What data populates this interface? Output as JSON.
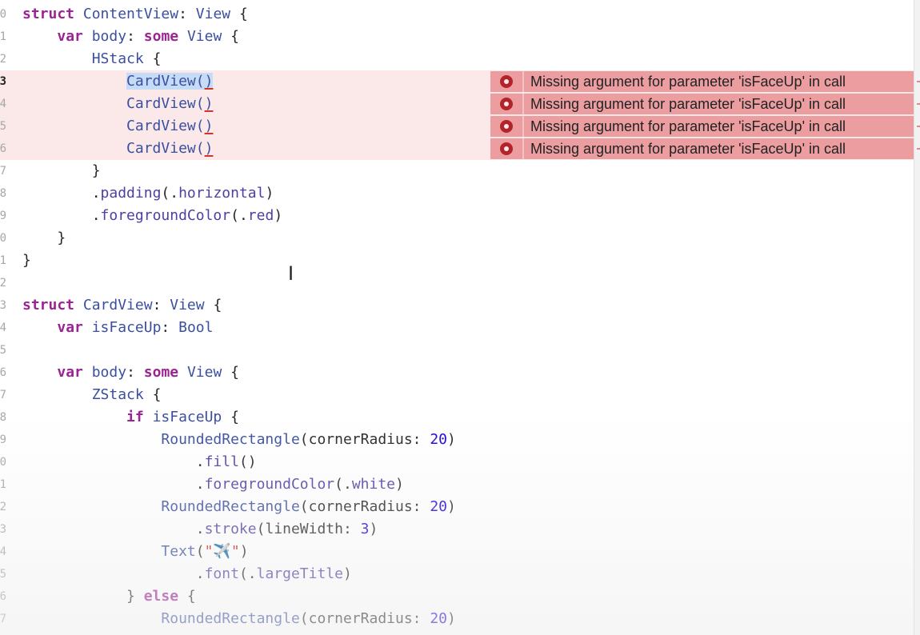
{
  "editor": {
    "lines": [
      {
        "n": "0",
        "tokens": [
          [
            "kw",
            "struct "
          ],
          [
            "ty",
            "ContentView"
          ],
          [
            "plain",
            ": "
          ],
          [
            "ty",
            "View"
          ],
          [
            "plain",
            " {"
          ]
        ]
      },
      {
        "n": "1",
        "tokens": [
          [
            "plain",
            "    "
          ],
          [
            "kw",
            "var "
          ],
          [
            "ty",
            "body"
          ],
          [
            "plain",
            ": "
          ],
          [
            "kw",
            "some "
          ],
          [
            "ty",
            "View"
          ],
          [
            "plain",
            " {"
          ]
        ]
      },
      {
        "n": "2",
        "tokens": [
          [
            "plain",
            "        "
          ],
          [
            "ty",
            "HStack"
          ],
          [
            "plain",
            " {"
          ]
        ]
      },
      {
        "n": "3",
        "tokens": [
          [
            "plain",
            "            "
          ],
          [
            "ty sel",
            "CardView("
          ],
          [
            "ty sel err-underline",
            ")"
          ]
        ],
        "error": true,
        "active": true
      },
      {
        "n": "4",
        "tokens": [
          [
            "plain",
            "            "
          ],
          [
            "ty",
            "CardView("
          ],
          [
            "ty err-underline",
            ")"
          ]
        ],
        "error": true
      },
      {
        "n": "5",
        "tokens": [
          [
            "plain",
            "            "
          ],
          [
            "ty",
            "CardView("
          ],
          [
            "ty err-underline",
            ")"
          ]
        ],
        "error": true
      },
      {
        "n": "6",
        "tokens": [
          [
            "plain",
            "            "
          ],
          [
            "ty",
            "CardView("
          ],
          [
            "ty err-underline",
            ")"
          ]
        ],
        "error": true
      },
      {
        "n": "7",
        "tokens": [
          [
            "plain",
            "        }"
          ]
        ]
      },
      {
        "n": "8",
        "tokens": [
          [
            "plain",
            "        ."
          ],
          [
            "fn",
            "padding"
          ],
          [
            "plain",
            "(."
          ],
          [
            "fn",
            "horizontal"
          ],
          [
            "plain",
            ")"
          ]
        ]
      },
      {
        "n": "9",
        "tokens": [
          [
            "plain",
            "        ."
          ],
          [
            "fn",
            "foregroundColor"
          ],
          [
            "plain",
            "(."
          ],
          [
            "fn",
            "red"
          ],
          [
            "plain",
            ")"
          ]
        ]
      },
      {
        "n": "0",
        "tokens": [
          [
            "plain",
            "    }"
          ]
        ]
      },
      {
        "n": "1",
        "tokens": [
          [
            "plain",
            "}"
          ]
        ]
      },
      {
        "n": "2",
        "tokens": []
      },
      {
        "n": "3",
        "tokens": [
          [
            "kw",
            "struct "
          ],
          [
            "ty",
            "CardView"
          ],
          [
            "plain",
            ": "
          ],
          [
            "ty",
            "View"
          ],
          [
            "plain",
            " {"
          ]
        ]
      },
      {
        "n": "4",
        "tokens": [
          [
            "plain",
            "    "
          ],
          [
            "kw",
            "var "
          ],
          [
            "ty",
            "isFaceUp"
          ],
          [
            "plain",
            ": "
          ],
          [
            "ty",
            "Bool"
          ]
        ]
      },
      {
        "n": "5",
        "tokens": []
      },
      {
        "n": "6",
        "tokens": [
          [
            "plain",
            "    "
          ],
          [
            "kw",
            "var "
          ],
          [
            "ty",
            "body"
          ],
          [
            "plain",
            ": "
          ],
          [
            "kw",
            "some "
          ],
          [
            "ty",
            "View"
          ],
          [
            "plain",
            " {"
          ]
        ]
      },
      {
        "n": "7",
        "tokens": [
          [
            "plain",
            "        "
          ],
          [
            "ty",
            "ZStack"
          ],
          [
            "plain",
            " {"
          ]
        ]
      },
      {
        "n": "8",
        "tokens": [
          [
            "plain",
            "            "
          ],
          [
            "kw",
            "if "
          ],
          [
            "ty",
            "isFaceUp"
          ],
          [
            "plain",
            " {"
          ]
        ]
      },
      {
        "n": "9",
        "tokens": [
          [
            "plain",
            "                "
          ],
          [
            "ty",
            "RoundedRectangle"
          ],
          [
            "plain",
            "(cornerRadius: "
          ],
          [
            "num",
            "20"
          ],
          [
            "plain",
            ")"
          ]
        ]
      },
      {
        "n": "0",
        "tokens": [
          [
            "plain",
            "                    ."
          ],
          [
            "fn",
            "fill"
          ],
          [
            "plain",
            "()"
          ]
        ]
      },
      {
        "n": "1",
        "tokens": [
          [
            "plain",
            "                    ."
          ],
          [
            "fn",
            "foregroundColor"
          ],
          [
            "plain",
            "(."
          ],
          [
            "fn",
            "white"
          ],
          [
            "plain",
            ")"
          ]
        ]
      },
      {
        "n": "2",
        "tokens": [
          [
            "plain",
            "                "
          ],
          [
            "ty",
            "RoundedRectangle"
          ],
          [
            "plain",
            "(cornerRadius: "
          ],
          [
            "num",
            "20"
          ],
          [
            "plain",
            ")"
          ]
        ]
      },
      {
        "n": "3",
        "tokens": [
          [
            "plain",
            "                    ."
          ],
          [
            "fn",
            "stroke"
          ],
          [
            "plain",
            "(lineWidth: "
          ],
          [
            "num",
            "3"
          ],
          [
            "plain",
            ")"
          ]
        ]
      },
      {
        "n": "4",
        "tokens": [
          [
            "plain",
            "                "
          ],
          [
            "ty",
            "Text"
          ],
          [
            "plain",
            "("
          ],
          [
            "str",
            "\"✈️\""
          ],
          [
            "plain",
            ")"
          ]
        ]
      },
      {
        "n": "5",
        "tokens": [
          [
            "plain",
            "                    ."
          ],
          [
            "fn",
            "font"
          ],
          [
            "plain",
            "(."
          ],
          [
            "fn",
            "largeTitle"
          ],
          [
            "plain",
            ")"
          ]
        ]
      },
      {
        "n": "6",
        "tokens": [
          [
            "plain",
            "            } "
          ],
          [
            "kw",
            "else"
          ],
          [
            "plain",
            " {"
          ]
        ]
      },
      {
        "n": "7",
        "tokens": [
          [
            "plain",
            "                "
          ],
          [
            "ty",
            "RoundedRectangle"
          ],
          [
            "plain",
            "(cornerRadius: "
          ],
          [
            "num",
            "20"
          ],
          [
            "plain",
            ")"
          ]
        ]
      }
    ]
  },
  "errors": [
    {
      "line_index": 3,
      "icon": "error-circle-icon",
      "message": "Missing argument for parameter 'isFaceUp' in call"
    },
    {
      "line_index": 4,
      "icon": "error-circle-icon",
      "message": "Missing argument for parameter 'isFaceUp' in call"
    },
    {
      "line_index": 5,
      "icon": "error-circle-icon",
      "message": "Missing argument for parameter 'isFaceUp' in call"
    },
    {
      "line_index": 6,
      "icon": "error-circle-icon",
      "message": "Missing argument for parameter 'isFaceUp' in call"
    }
  ],
  "colors": {
    "keyword": "#9b2393",
    "type": "#3a4fa0",
    "function": "#4f3ea3",
    "number": "#1c00cf",
    "error_band": "#fbe9ea",
    "error_message": "#ec9da0",
    "error_icon": "#b3232c",
    "selection": "#c6dcf6"
  },
  "cursor": {
    "icon": "text-cursor-icon",
    "glyph": "I"
  }
}
